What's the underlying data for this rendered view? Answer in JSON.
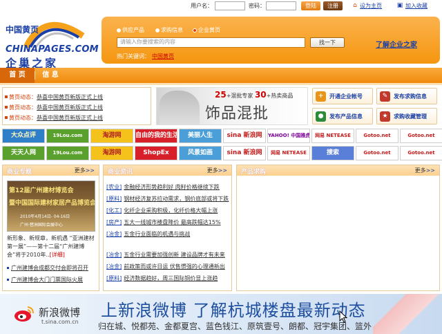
{
  "topbar": {
    "username_label": "用户名：",
    "password_label": "密码：",
    "login_label": "登陆",
    "register_label": "注册",
    "homepage_link": "设为主页",
    "favorite_link": "加入收藏"
  },
  "logo": {
    "zh_top": "中国黄页",
    "en": "CHINAPAGES.COM",
    "zh_bottom": "企巢之家"
  },
  "search": {
    "radios": [
      {
        "label": "供应产品",
        "selected": false
      },
      {
        "label": "求购信息",
        "selected": false
      },
      {
        "label": "企业黄页",
        "selected": true
      }
    ],
    "placeholder": "请输入你要搜索的内容",
    "button_label": "找一下",
    "learn_link": "了解企业之家",
    "hot_label": "热门关键词：",
    "hot_word": "中国黄页"
  },
  "nav": {
    "tabs": [
      {
        "label": "首 页",
        "active": true
      },
      {
        "label": "信 息",
        "active": false
      }
    ]
  },
  "news": {
    "rows": [
      {
        "prefix": "黄页动态：",
        "text": "恭喜中国黄页新版正式上线"
      },
      {
        "prefix": "黄页动态：",
        "text": "恭喜中国黄页新版正式上线"
      },
      {
        "prefix": "黄页动态：",
        "text": "恭喜中国黄页新版正式上线"
      }
    ]
  },
  "banner": {
    "num1": "25",
    "text1": "+混批专家",
    "num2": "30",
    "text2": "+热卖商品",
    "main": "饰品混批"
  },
  "actions": [
    {
      "label": "开通企业帐号",
      "icon": "add-account-icon",
      "color": "#e8961a",
      "glyph": "+"
    },
    {
      "label": "发布求购信息",
      "icon": "buy-info-icon",
      "color": "#c0392b",
      "glyph": "✎"
    },
    {
      "label": "发布产品信息",
      "icon": "product-info-icon",
      "color": "#2e8b3a",
      "glyph": "●"
    },
    {
      "label": "求购收藏管理",
      "icon": "favorites-manage-icon",
      "color": "#c0392b",
      "glyph": "★"
    }
  ],
  "partner_logos": [
    {
      "label": "大众点评",
      "bg": "#2f7fc8",
      "fg": "#fff8c0"
    },
    {
      "label": "19Lou.com",
      "bg": "#5aa02c",
      "fg": "#fff"
    },
    {
      "label": "淘游网",
      "bg": "#f4c21a",
      "fg": "#b22222"
    },
    {
      "label": "自由的我的生活",
      "bg": "#d8202a",
      "fg": "#fff"
    },
    {
      "label": "美丽人生",
      "bg": "#4a9fd8",
      "fg": "#fff"
    },
    {
      "label": "sina 新浪网",
      "bg": "#ffffff",
      "fg": "#c41a1a"
    },
    {
      "label": "YAHOO! 中国雅虎",
      "bg": "#ffffff",
      "fg": "#7b0099"
    },
    {
      "label": "网易 NETEASE",
      "bg": "#ffffff",
      "fg": "#c41a1a"
    },
    {
      "label": "Gotoo.net",
      "bg": "#ffffff",
      "fg": "#c41a1a"
    },
    {
      "label": "Gotoo.net",
      "bg": "#ffffff",
      "fg": "#c41a1a"
    },
    {
      "label": "天天人网",
      "bg": "#5aa02c",
      "fg": "#fff"
    },
    {
      "label": "19Lou.com",
      "bg": "#5aa02c",
      "fg": "#fff"
    },
    {
      "label": "淘游网",
      "bg": "#f4c21a",
      "fg": "#b22222"
    },
    {
      "label": "ShopEx",
      "bg": "#d8202a",
      "fg": "#fff"
    },
    {
      "label": "风景如画",
      "bg": "#4a9fd8",
      "fg": "#fff"
    },
    {
      "label": "sina 新浪网",
      "bg": "#ffffff",
      "fg": "#c41a1a"
    },
    {
      "label": "网易 NETEASE",
      "bg": "#ffffff",
      "fg": "#c41a1a"
    },
    {
      "label": "搜索",
      "bg": "#5a7fd8",
      "fg": "#fff"
    },
    {
      "label": "Gotoo.net",
      "bg": "#ffffff",
      "fg": "#c41a1a"
    },
    {
      "label": "Gotoo.net",
      "bg": "#ffffff",
      "fg": "#c41a1a"
    }
  ],
  "panel_business": {
    "title": "商业专题",
    "more": "更多",
    "img_line1": "第12届广州建材博览会",
    "img_line2": "暨中国国际建材家居产品博览会",
    "img_line3": "2010年4月14日- 04-16日",
    "img_line4": "广州·琶洲国际会展中心",
    "desc": "新形象、新规章，新机遇 “亚洲建材第一展”——第十二届“广州建博会”将于2010年..",
    "desc_more": "[详细]",
    "items": [
      "广州建博会成都交付会即将召开",
      "广州建博会大门门票国际火展"
    ]
  },
  "panel_news": {
    "title": "商业资讯",
    "more": "更多",
    "items": [
      {
        "cat": "[农业]",
        "title": "金融经济形势趋利好 肉籽价格继续下跌"
      },
      {
        "cat": "[原料]",
        "title": "钢材经济复苏拉动需求，钢价底部或将下跌"
      },
      {
        "cat": "[化工]",
        "title": "化纤企业采购积极，化纤价格大幅上涨"
      },
      {
        "cat": "[房产]",
        "title": "五大一线城市楼盘降价 最高跌幅达15%"
      },
      {
        "cat": "[冶金]",
        "title": "五金行业面临的机遇与挑战"
      },
      {
        "cat": "[冶金]",
        "title": "五金行业需要加强创新 建设品牌才有未来"
      },
      {
        "cat": "[冶金]",
        "title": "前政策而或许日运 伏售惯强的心理通新出"
      },
      {
        "cat": "[原料]",
        "title": "经济数据趋好，周三国际铜价显上涨趋"
      }
    ]
  },
  "panel_buy": {
    "title": "产品求购",
    "more": "更多"
  },
  "weibo": {
    "name": "新浪微博",
    "url": "t.sina.com.cn",
    "title": "上新浪微博 了解杭城楼盘最新动态",
    "sub": "归在城、悦都苑、金都夏宫、蓝色钱江、原筑壹号、朗都、冠宇集团、篮外"
  }
}
